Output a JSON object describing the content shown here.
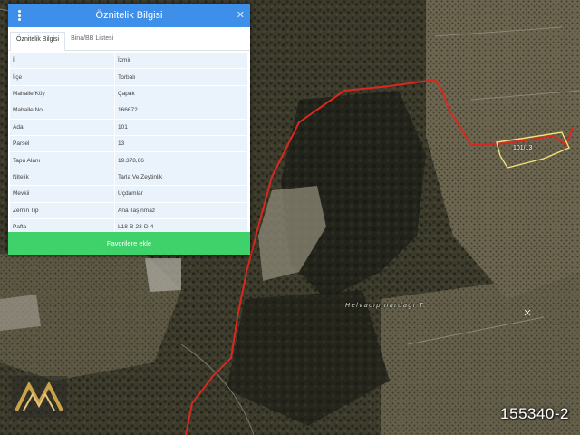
{
  "panel": {
    "title": "Öznitelik Bilgisi",
    "tabs": [
      {
        "label": "Öznitelik Bilgisi",
        "active": true
      },
      {
        "label": "Bina/BB Listesi",
        "active": false
      }
    ],
    "rows": [
      {
        "key": "İl",
        "value": "İzmir"
      },
      {
        "key": "İlçe",
        "value": "Torbalı"
      },
      {
        "key": "Mahalle/Köy",
        "value": "Çapak"
      },
      {
        "key": "Mahalle No",
        "value": "166672"
      },
      {
        "key": "Ada",
        "value": "101"
      },
      {
        "key": "Parsel",
        "value": "13"
      },
      {
        "key": "Tapu Alanı",
        "value": "19.378,66"
      },
      {
        "key": "Nitelik",
        "value": "Tarla Ve Zeytinlik"
      },
      {
        "key": "Mevkii",
        "value": "Uçdamlar"
      },
      {
        "key": "Zemin Tip",
        "value": "Ana Taşınmaz"
      },
      {
        "key": "Pafta",
        "value": "L18-B-23-D-4"
      }
    ],
    "favorite_button": "Favorilere ekle",
    "header_color": "#3d8fe9",
    "button_color": "#3fd26a"
  },
  "map": {
    "place_label": "Helvacıpınardağı T.",
    "parcel_label": "101/13",
    "listing_number": "155340-2",
    "boundary_color": "#d8281f",
    "parcel_color": "#f2e27a",
    "watermark": "/"
  },
  "icons": {
    "menu": "more-vert-icon",
    "close": "close-icon",
    "logo": "brand-logo"
  }
}
